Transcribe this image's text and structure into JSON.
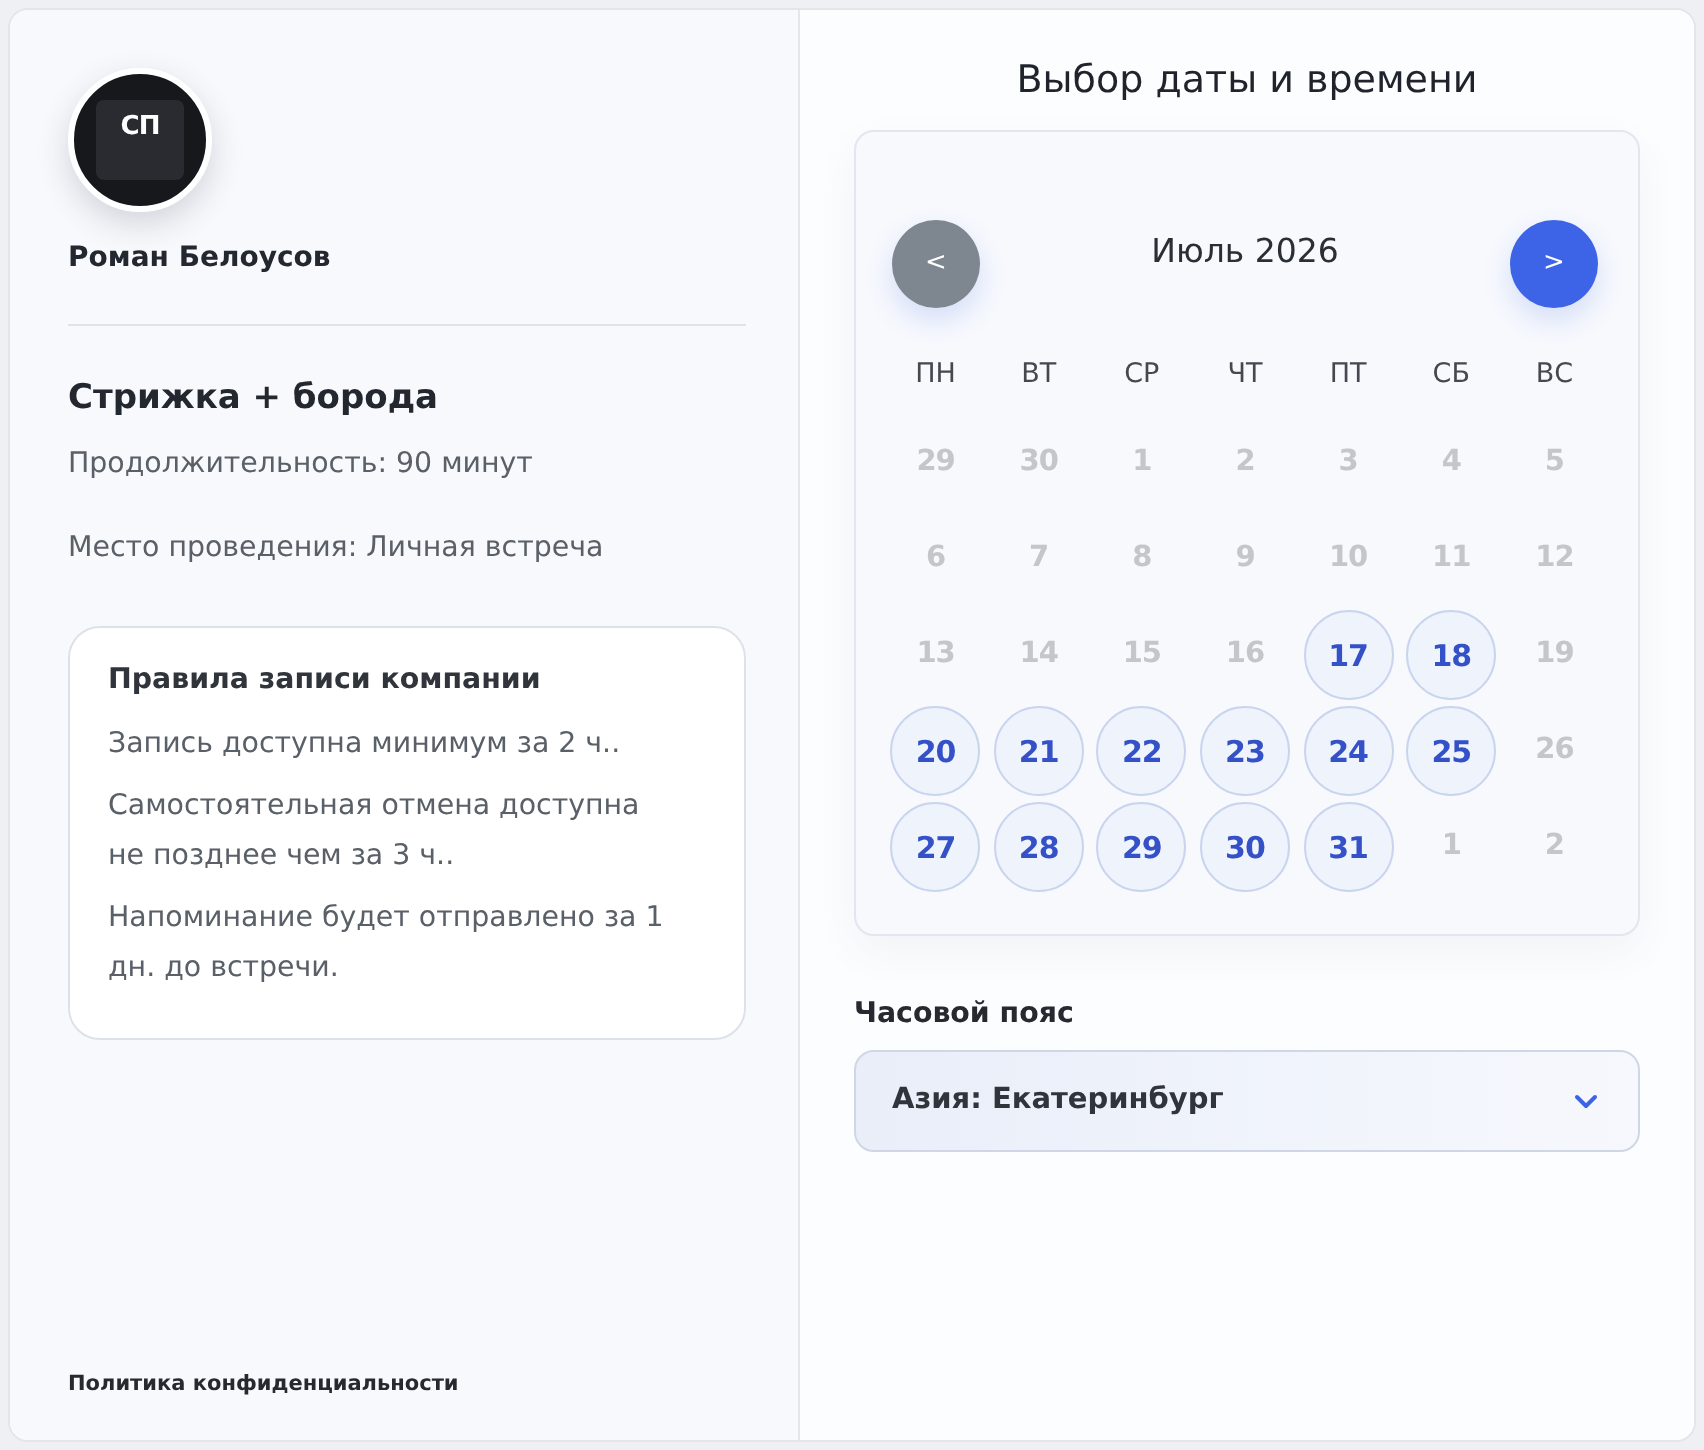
{
  "specialist": {
    "logo_text": "СП",
    "name": "Роман Белоусов"
  },
  "service": {
    "title": "Стрижка + борода",
    "details": [
      "Продолжительность: 90 минут",
      "Место проведения: Личная встреча"
    ]
  },
  "rules": {
    "title": "Правила записи компании",
    "items": [
      "Запись доступна минимум за 2 ч..",
      "Самостоятельная отмена доступна не позднее чем за 3 ч..",
      "Напоминание будет отправлено за 1 дн. до встречи."
    ]
  },
  "privacy_link": "Политика конфиденциальности",
  "booking": {
    "title": "Выбор даты и времени",
    "calendar": {
      "prev_button": {
        "label": "<",
        "disabled": true
      },
      "month": "Июль 2026",
      "next_button": {
        "label": ">",
        "disabled": false
      },
      "weekdays": [
        "ПН",
        "ВТ",
        "СР",
        "ЧТ",
        "ПТ",
        "СБ",
        "ВС"
      ],
      "weeks": [
        [
          {
            "day": "29",
            "available": false
          },
          {
            "day": "30",
            "available": false
          },
          {
            "day": "1",
            "available": false
          },
          {
            "day": "2",
            "available": false
          },
          {
            "day": "3",
            "available": false
          },
          {
            "day": "4",
            "available": false
          },
          {
            "day": "5",
            "available": false
          }
        ],
        [
          {
            "day": "6",
            "available": false
          },
          {
            "day": "7",
            "available": false
          },
          {
            "day": "8",
            "available": false
          },
          {
            "day": "9",
            "available": false
          },
          {
            "day": "10",
            "available": false
          },
          {
            "day": "11",
            "available": false
          },
          {
            "day": "12",
            "available": false
          }
        ],
        [
          {
            "day": "13",
            "available": false
          },
          {
            "day": "14",
            "available": false
          },
          {
            "day": "15",
            "available": false
          },
          {
            "day": "16",
            "available": false
          },
          {
            "day": "17",
            "available": true
          },
          {
            "day": "18",
            "available": true
          },
          {
            "day": "19",
            "available": false
          }
        ],
        [
          {
            "day": "20",
            "available": true
          },
          {
            "day": "21",
            "available": true
          },
          {
            "day": "22",
            "available": true
          },
          {
            "day": "23",
            "available": true
          },
          {
            "day": "24",
            "available": true
          },
          {
            "day": "25",
            "available": true
          },
          {
            "day": "26",
            "available": false
          }
        ],
        [
          {
            "day": "27",
            "available": true
          },
          {
            "day": "28",
            "available": true
          },
          {
            "day": "29",
            "available": true
          },
          {
            "day": "30",
            "available": true
          },
          {
            "day": "31",
            "available": true
          },
          {
            "day": "1",
            "available": false
          },
          {
            "day": "2",
            "available": false
          }
        ]
      ]
    },
    "timezone": {
      "label": "Часовой пояс",
      "value": "Азия: Екатеринбург"
    }
  }
}
